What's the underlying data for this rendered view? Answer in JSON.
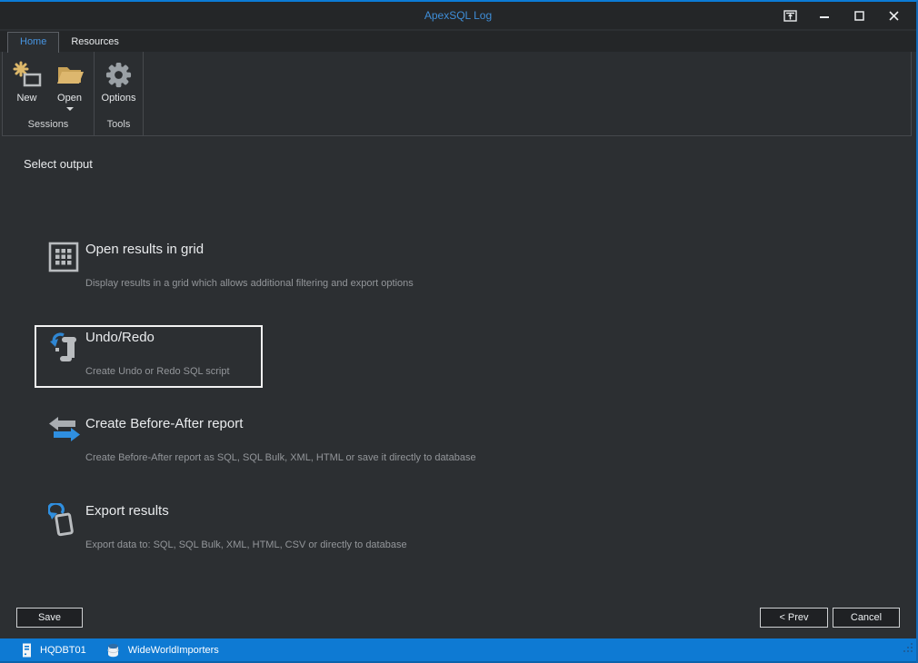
{
  "window": {
    "title": "ApexSQL Log"
  },
  "tabs": [
    {
      "label": "Home",
      "active": true
    },
    {
      "label": "Resources",
      "active": false
    }
  ],
  "ribbon": {
    "buttons": [
      {
        "label": "New",
        "icon": "new-session-icon"
      },
      {
        "label": "Open",
        "icon": "open-folder-icon",
        "has_dropdown": true
      },
      {
        "label": "Options",
        "icon": "gear-icon"
      }
    ],
    "groups": [
      {
        "label": "Sessions"
      },
      {
        "label": "Tools"
      }
    ]
  },
  "content": {
    "heading": "Select output",
    "options": [
      {
        "title": "Open results in grid",
        "description": "Display results in a grid which allows additional filtering and export options",
        "icon": "grid-icon",
        "selected": false
      },
      {
        "title": "Undo/Redo",
        "description": "Create Undo or Redo SQL script",
        "icon": "undo-redo-script-icon",
        "selected": true
      },
      {
        "title": "Create Before-After report",
        "description": "Create Before-After report as SQL, SQL Bulk, XML, HTML or save it directly to database",
        "icon": "before-after-arrows-icon",
        "selected": false
      },
      {
        "title": "Export results",
        "description": "Export data to: SQL, SQL Bulk, XML, HTML, CSV or directly to database",
        "icon": "export-document-icon",
        "selected": false
      }
    ]
  },
  "footer": {
    "save_label": "Save",
    "prev_label": "< Prev",
    "cancel_label": "Cancel"
  },
  "statusbar": {
    "server": "HQDBT01",
    "database": "WideWorldImporters"
  },
  "colors": {
    "accent_blue": "#0e7ad3",
    "title_blue": "#3f8ed8",
    "active_tab_blue": "#4795e2",
    "icon_tan": "#d8b269",
    "icon_gray": "#b9bcbf",
    "icon_blue": "#2f8fe0",
    "selection_border": "#f2f2f2",
    "background_dark": "#2c2f32"
  }
}
